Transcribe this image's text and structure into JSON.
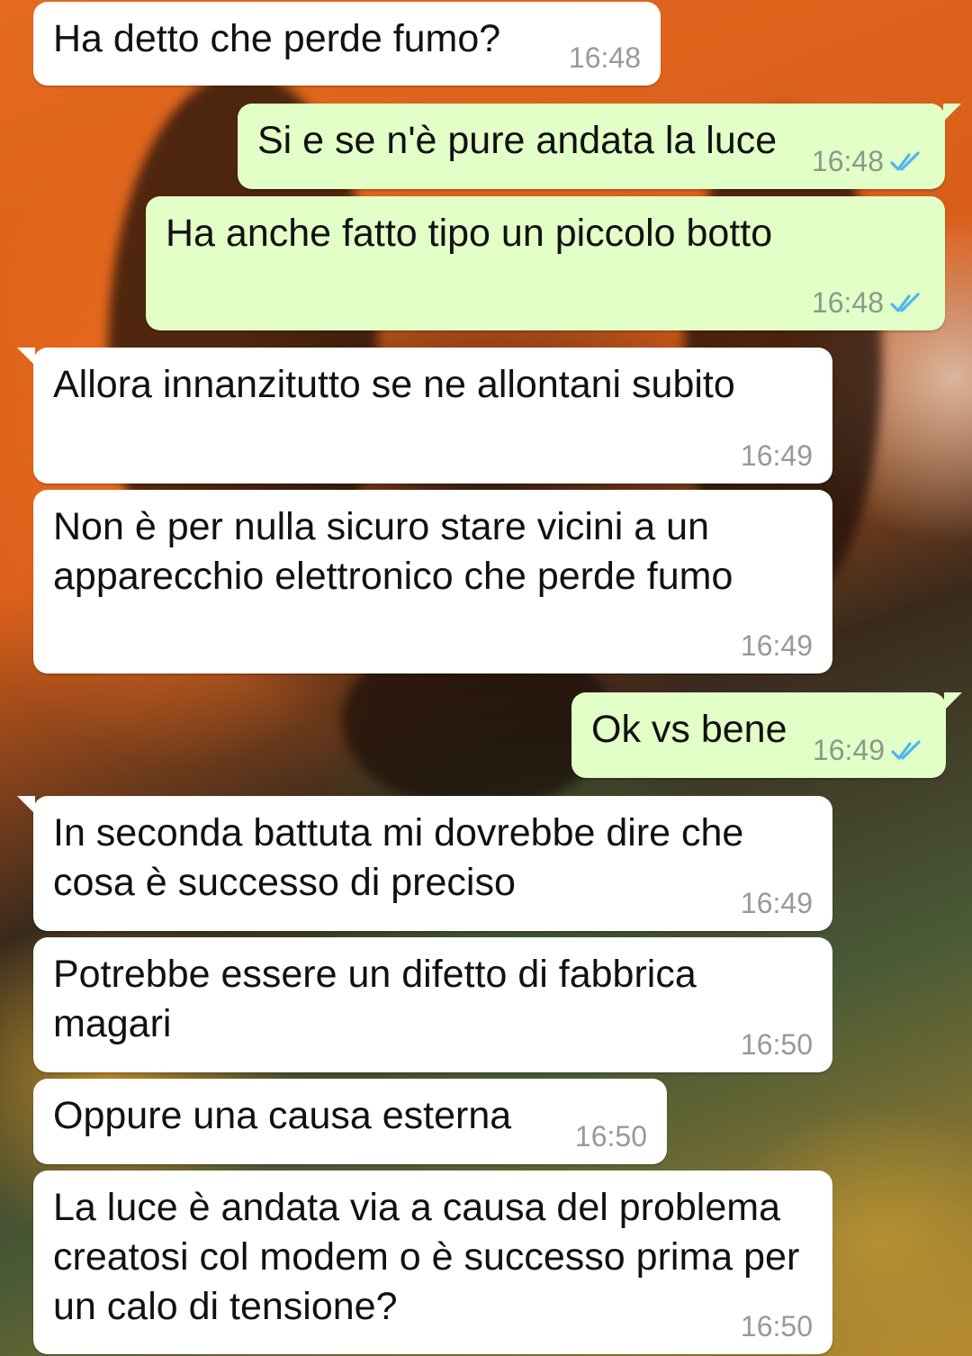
{
  "colors": {
    "incoming_bubble": "#ffffff",
    "outgoing_bubble": "#e2ffc7",
    "read_ticks": "#4fb6ec",
    "timestamp": "#999999"
  },
  "messages": [
    {
      "direction": "in",
      "text": "Ha detto che perde fumo?",
      "time": "16:48"
    },
    {
      "direction": "out",
      "text": "Si e se n'è pure andata la luce",
      "time": "16:48",
      "status": "read"
    },
    {
      "direction": "out",
      "text": "Ha anche fatto tipo un piccolo botto",
      "time": "16:48",
      "status": "read"
    },
    {
      "direction": "in",
      "text": "Allora innanzitutto se ne allontani subito",
      "time": "16:49"
    },
    {
      "direction": "in",
      "text": "Non è per nulla sicuro stare vicini a un apparecchio elettronico che perde fumo",
      "time": "16:49"
    },
    {
      "direction": "out",
      "text": "Ok vs bene",
      "time": "16:49",
      "status": "read"
    },
    {
      "direction": "in",
      "text": "In seconda battuta mi dovrebbe dire che cosa è successo di preciso",
      "time": "16:49"
    },
    {
      "direction": "in",
      "text": "Potrebbe essere un difetto di fabbrica magari",
      "time": "16:50"
    },
    {
      "direction": "in",
      "text": "Oppure una causa esterna",
      "time": "16:50"
    },
    {
      "direction": "in",
      "text": "La luce è andata via a causa del problema creatosi col modem o è successo prima per un calo di tensione?",
      "time": "16:50"
    }
  ]
}
